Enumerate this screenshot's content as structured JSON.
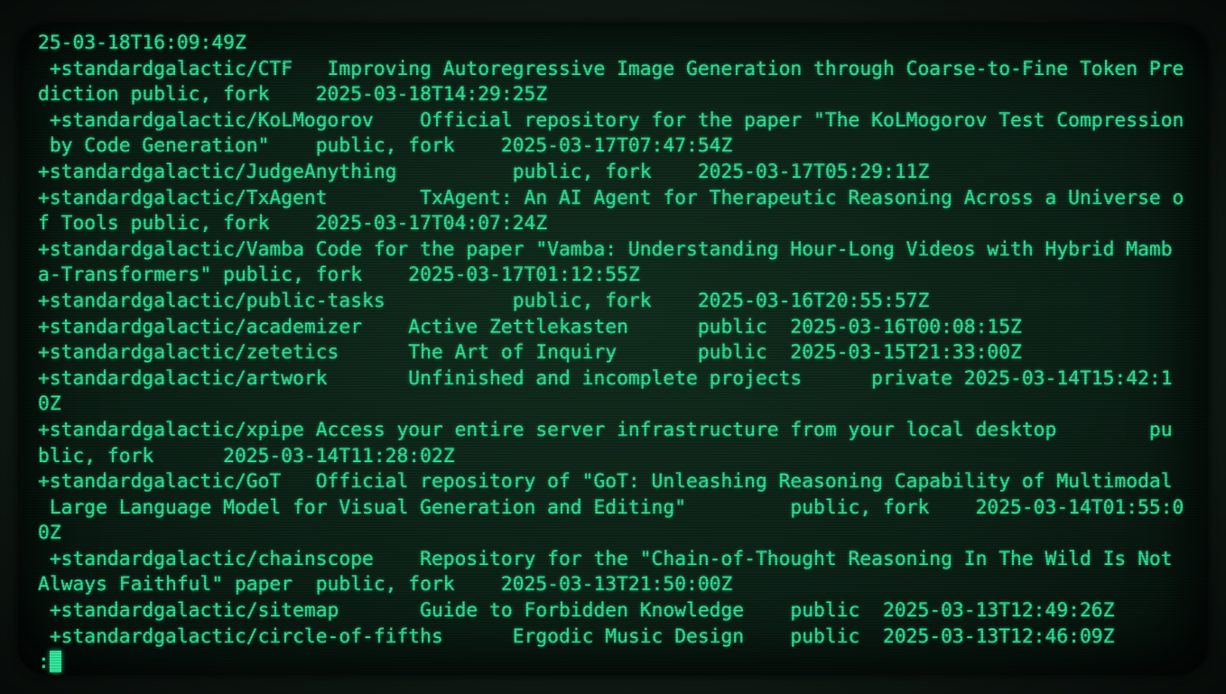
{
  "terminal": {
    "lines": [
      "25-03-18T16:09:49Z",
      " +standardgalactic/CTF   Improving Autoregressive Image Generation through Coarse-to-Fine Token Pre",
      "diction public, fork    2025-03-18T14:29:25Z",
      " +standardgalactic/KoLMogorov    Official repository for the paper \"The KoLMogorov Test Compression",
      " by Code Generation\"    public, fork    2025-03-17T07:47:54Z",
      "+standardgalactic/JudgeAnything          public, fork    2025-03-17T05:29:11Z",
      "+standardgalactic/TxAgent        TxAgent: An AI Agent for Therapeutic Reasoning Across a Universe o",
      "f Tools public, fork    2025-03-17T04:07:24Z",
      "+standardgalactic/Vamba Code for the paper \"Vamba: Understanding Hour-Long Videos with Hybrid Mamb",
      "a-Transformers\" public, fork    2025-03-17T01:12:55Z",
      "+standardgalactic/public-tasks           public, fork    2025-03-16T20:55:57Z",
      "+standardgalactic/academizer    Active Zettlekasten      public  2025-03-16T00:08:15Z",
      "+standardgalactic/zetetics      The Art of Inquiry       public  2025-03-15T21:33:00Z",
      "+standardgalactic/artwork       Unfinished and incomplete projects      private 2025-03-14T15:42:1",
      "0Z",
      "+standardgalactic/xpipe Access your entire server infrastructure from your local desktop        pu",
      "blic, fork      2025-03-14T11:28:02Z",
      "+standardgalactic/GoT   Official repository of \"GoT: Unleashing Reasoning Capability of Multimodal",
      " Large Language Model for Visual Generation and Editing\"         public, fork    2025-03-14T01:55:0",
      "0Z",
      " +standardgalactic/chainscope    Repository for the \"Chain-of-Thought Reasoning In The Wild Is Not",
      "Always Faithful\" paper  public, fork    2025-03-13T21:50:00Z",
      " +standardgalactic/sitemap       Guide to Forbidden Knowledge    public  2025-03-13T12:49:26Z",
      " +standardgalactic/circle-of-fifths      Ergodic Music Design    public  2025-03-13T12:46:09Z"
    ],
    "prompt": ":"
  },
  "colors": {
    "phosphor_text": "#2ee89a",
    "screen_background": "#0d2418",
    "bezel": "#0e1712"
  }
}
